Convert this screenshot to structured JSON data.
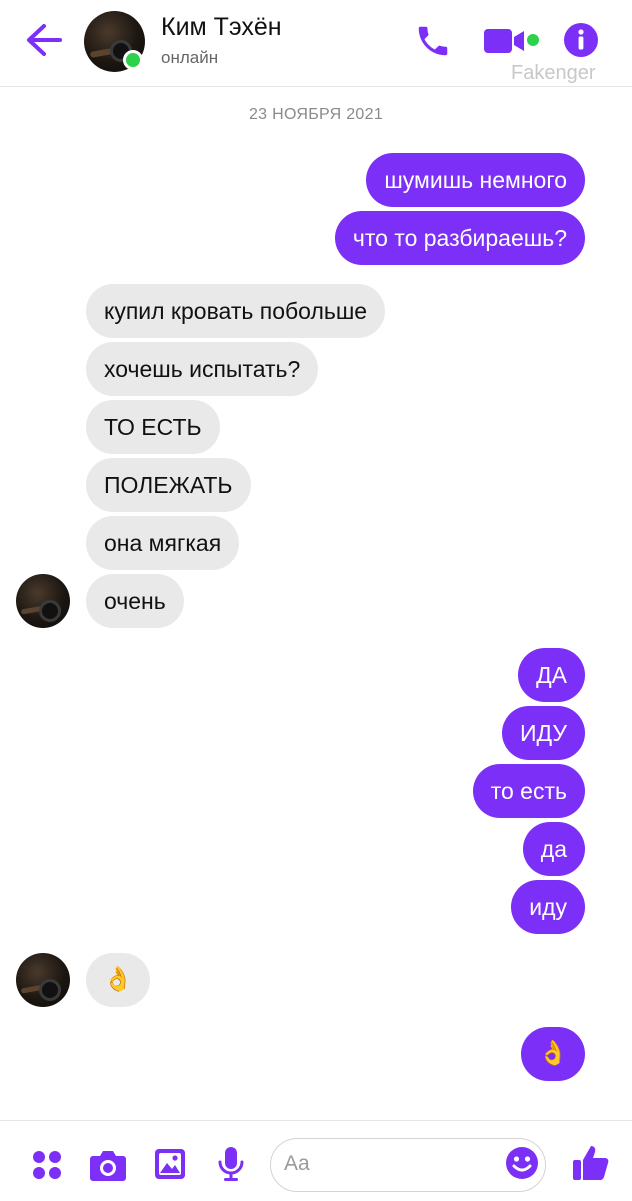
{
  "header": {
    "contact_name": "Ким Тэхён",
    "status": "онлайн",
    "watermark": "Fakenger",
    "accent_color": "#7b2ff7",
    "online_color": "#2bd24a",
    "icons": [
      "back-arrow-icon",
      "phone-icon",
      "video-camera-icon",
      "info-icon"
    ]
  },
  "conversation": {
    "date_separator": "23 НОЯБРЯ 2021",
    "messages": [
      {
        "from": "me",
        "text": "шумишь немного"
      },
      {
        "from": "me",
        "text": "что то разбираешь?"
      },
      {
        "from": "them",
        "text": "купил кровать побольше"
      },
      {
        "from": "them",
        "text": "хочешь испытать?"
      },
      {
        "from": "them",
        "text": "ТО ЕСТЬ"
      },
      {
        "from": "them",
        "text": "ПОЛЕЖАТЬ"
      },
      {
        "from": "them",
        "text": "она мягкая"
      },
      {
        "from": "them",
        "text": "очень"
      },
      {
        "from": "me",
        "text": "ДА"
      },
      {
        "from": "me",
        "text": "ИДУ"
      },
      {
        "from": "me",
        "text": "то есть"
      },
      {
        "from": "me",
        "text": "да"
      },
      {
        "from": "me",
        "text": "иду"
      },
      {
        "from": "them",
        "text": "👌"
      },
      {
        "from": "me",
        "text": "👌"
      }
    ]
  },
  "composer": {
    "placeholder": "Aa",
    "icons": [
      "more-apps-icon",
      "camera-icon",
      "gallery-image-icon",
      "microphone-icon",
      "emoji-icon",
      "thumbs-up-icon"
    ]
  }
}
